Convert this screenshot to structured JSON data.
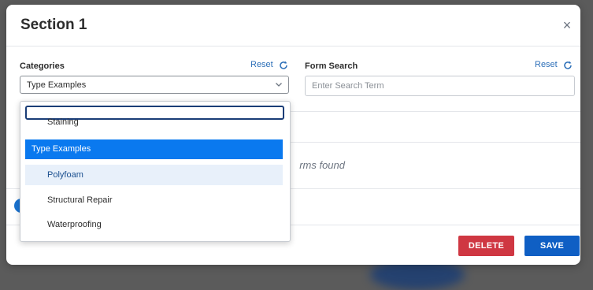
{
  "modal": {
    "title": "Section 1",
    "close_label": "×"
  },
  "categories": {
    "label": "Categories",
    "reset_label": "Reset",
    "selected_value": "Type Examples"
  },
  "form_search": {
    "label": "Form Search",
    "reset_label": "Reset",
    "placeholder": "Enter Search Term",
    "value": ""
  },
  "results": {
    "empty_text_partial": "rms found"
  },
  "dropdown": {
    "options": [
      {
        "label": "Staining",
        "kind": "option",
        "state": "partially-visible"
      },
      {
        "label": "Type Examples",
        "kind": "group",
        "state": "selected"
      },
      {
        "label": "Polyfoam",
        "kind": "option",
        "state": "hover"
      },
      {
        "label": "Structural Repair",
        "kind": "option",
        "state": "normal"
      },
      {
        "label": "Waterproofing",
        "kind": "option",
        "state": "normal"
      }
    ]
  },
  "footer": {
    "delete_label": "DELETE",
    "save_label": "SAVE"
  },
  "colors": {
    "accent_blue": "#0a79ef",
    "save_blue": "#0f5fc4",
    "delete_red": "#cf3742",
    "link_blue": "#2c6fb8"
  },
  "icons": {
    "reset": "refresh-icon",
    "close": "close-icon",
    "select": "chevron-down-icon"
  }
}
